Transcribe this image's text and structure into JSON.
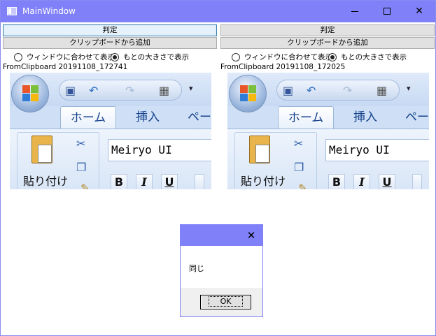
{
  "window": {
    "title": "MainWindow",
    "minimize_glyph": "—",
    "maximize_glyph": "☐",
    "close_glyph": "✕"
  },
  "panels": [
    {
      "judge_label": "判定",
      "clipboard_label": "クリップボードから追加",
      "radio_fit": "ウィンドウに合わせて表示",
      "radio_original": "もとの大きさで表示",
      "caption": "FromClipboard 20191108_172741"
    },
    {
      "judge_label": "判定",
      "clipboard_label": "クリップボードから追加",
      "radio_fit": "ウィンドウに合わせて表示",
      "radio_original": "もとの大きさで表示",
      "caption": "FromClipboard 20191108_172025"
    }
  ],
  "ribbon": {
    "tab_home": "ホーム",
    "tab_insert": "挿入",
    "tab_page": "ペー",
    "paste_label": "貼り付け",
    "font_name": "Meiryo UI",
    "bold": "B",
    "italic": "I",
    "underline": "U"
  },
  "dialog": {
    "message": "同じ",
    "ok_label": "OK",
    "close_glyph": "✕"
  },
  "colors": {
    "titlebar": "#8080f8",
    "button_face": "#e1e1e1",
    "focused_border": "#3c7fb1"
  }
}
